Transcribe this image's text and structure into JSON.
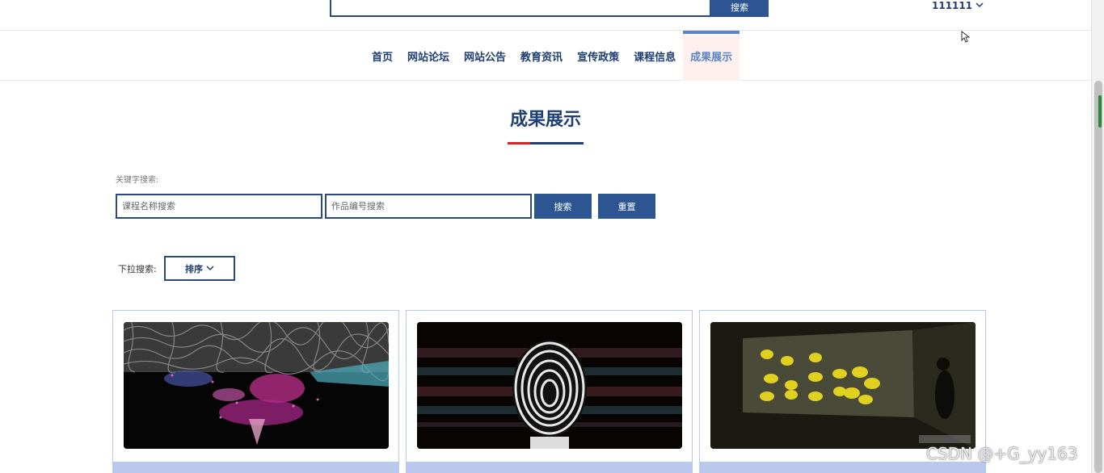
{
  "topbar": {
    "search_button": "搜索",
    "user_name": "111111"
  },
  "nav": {
    "items": [
      {
        "label": "首页"
      },
      {
        "label": "网站论坛"
      },
      {
        "label": "网站公告"
      },
      {
        "label": "教育资讯"
      },
      {
        "label": "宣传政策"
      },
      {
        "label": "课程信息"
      },
      {
        "label": "成果展示",
        "active": true
      }
    ]
  },
  "section": {
    "title": "成果展示"
  },
  "search": {
    "keyword_label": "关键字搜索:",
    "course_placeholder": "课程名称搜索",
    "work_no_placeholder": "作品编号搜索",
    "search_button": "搜索",
    "reset_button": "重置"
  },
  "dropdown": {
    "label": "下拉搜索:",
    "sort_label": "排序"
  },
  "cards": [
    {
      "image": "particle-artwork"
    },
    {
      "image": "striped-face-artwork"
    },
    {
      "image": "projected-horses-artwork"
    }
  ],
  "watermark": "CSDN @+G_yy163",
  "colors": {
    "primary": "#2d5592",
    "nav_text": "#1f3e72",
    "accent_red": "#e02020",
    "card_footer": "#b9c8ec"
  }
}
